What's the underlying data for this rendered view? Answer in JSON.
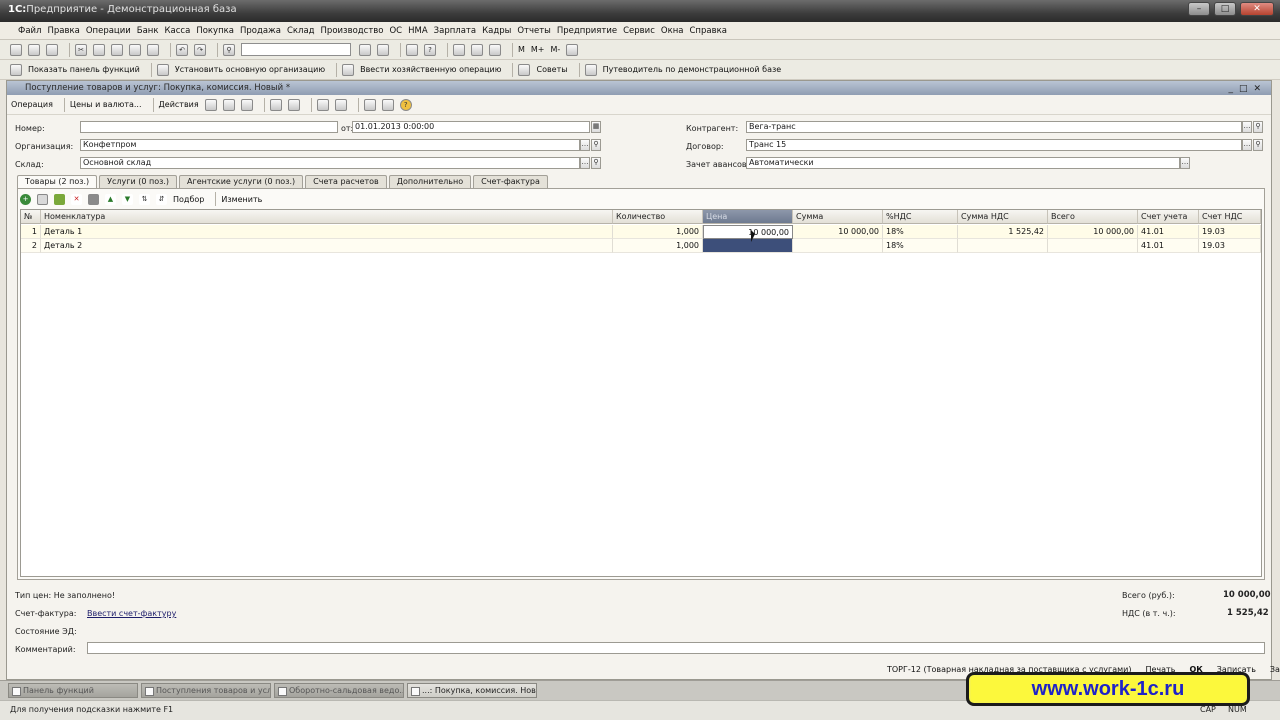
{
  "app": {
    "title_prefix": "1С:",
    "title": "Предприятие - Демонстрационная база"
  },
  "menu": [
    "Файл",
    "Правка",
    "Операции",
    "Банк",
    "Касса",
    "Покупка",
    "Продажа",
    "Склад",
    "Производство",
    "ОС",
    "НМА",
    "Зарплата",
    "Кадры",
    "Отчеты",
    "Предприятие",
    "Сервис",
    "Окна",
    "Справка"
  ],
  "toolbar2": {
    "show_panel": "Показать панель функций",
    "set_org": "Установить основную организацию",
    "enter_op": "Ввести хозяйственную операцию",
    "tips": "Советы",
    "guide": "Путеводитель по демонстрационной базе"
  },
  "doc": {
    "title": "Поступление товаров и услуг: Покупка, комиссия. Новый *",
    "toolbar": {
      "operation": "Операция",
      "prices": "Цены и валюта...",
      "actions": "Действия"
    },
    "fields": {
      "number_label": "Номер:",
      "number_value": "",
      "date_label": "от:",
      "date_value": "01.01.2013  0:00:00",
      "org_label": "Организация:",
      "org_value": "Конфетпром",
      "warehouse_label": "Склад:",
      "warehouse_value": "Основной склад",
      "contractor_label": "Контрагент:",
      "contractor_value": "Вега-транс",
      "contract_label": "Договор:",
      "contract_value": "Транс 15",
      "advance_label": "Зачет авансов:",
      "advance_value": "Автоматически"
    },
    "tabs": [
      "Товары (2 поз.)",
      "Услуги (0 поз.)",
      "Агентские услуги (0 поз.)",
      "Счета расчетов",
      "Дополнительно",
      "Счет-фактура"
    ],
    "grid_toolbar": {
      "pick": "Подбор",
      "change": "Изменить"
    },
    "columns": [
      "№",
      "Номенклатура",
      "Количество",
      "Цена",
      "Сумма",
      "%НДС",
      "Сумма НДС",
      "Всего",
      "Счет учета",
      "Счет НДС"
    ],
    "rows": [
      {
        "n": "1",
        "name": "Деталь 1",
        "qty": "1,000",
        "price": "10 000,00",
        "sum": "10 000,00",
        "vat_rate": "18%",
        "vat_sum": "1 525,42",
        "total": "10 000,00",
        "account": "41.01",
        "vat_account": "19.03"
      },
      {
        "n": "2",
        "name": "Деталь 2",
        "qty": "1,000",
        "price": "",
        "sum": "",
        "vat_rate": "18%",
        "vat_sum": "",
        "total": "",
        "account": "41.01",
        "vat_account": "19.03"
      }
    ],
    "footer": {
      "price_type": "Тип цен: Не заполнено!",
      "invoice_label": "Счет-фактура:",
      "invoice_link": "Ввести счет-фактуру",
      "edo_label": "Состояние ЭД:",
      "comment_label": "Комментарий:",
      "total_label": "Всего (руб.):",
      "total_value": "10 000,00",
      "vat_label": "НДС (в т. ч.):",
      "vat_value": "1 525,42"
    },
    "bottom_bar": {
      "torg": "ТОРГ-12 (Товарная накладная за поставщика с услугами)",
      "print": "Печать",
      "ok": "ОК",
      "save": "Записать",
      "close": "Закрыть"
    }
  },
  "taskbar": [
    "Панель функций",
    "Поступления товаров и услуг",
    "Оборотно-сальдовая ведо...",
    "...: Покупка, комиссия. Нов..."
  ],
  "hint": "Для получения подсказки нажмите F1",
  "indicators": [
    "CAP",
    "NUM"
  ],
  "watermark": "www.work-1c.ru"
}
